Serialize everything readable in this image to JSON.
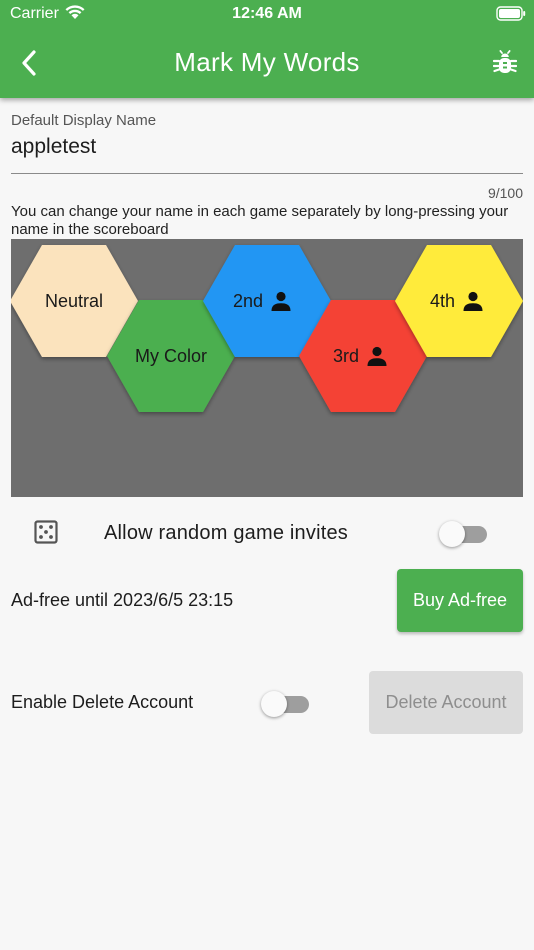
{
  "status_bar": {
    "carrier": "Carrier",
    "time": "12:46 AM"
  },
  "app_bar": {
    "title": "Mark My Words",
    "back_icon": "chevron-left-icon",
    "action_icon": "bug-icon",
    "color": "#4caf50"
  },
  "display_name": {
    "label": "Default Display Name",
    "value": "appletest",
    "counter": "9/100",
    "helper": "You can change your name in each game separately by long-pressing your name in the scoreboard"
  },
  "color_board": {
    "background": "#6e6e6e",
    "hexes": [
      {
        "label": "Neutral",
        "color": "#fbe3bd",
        "player_icon": false
      },
      {
        "label": "My Color",
        "color": "#4caf50",
        "player_icon": false
      },
      {
        "label": "2nd",
        "color": "#2196f3",
        "player_icon": true
      },
      {
        "label": "3rd",
        "color": "#f44336",
        "player_icon": true
      },
      {
        "label": "4th",
        "color": "#ffeb3b",
        "player_icon": true
      }
    ]
  },
  "random_invites": {
    "icon": "dice-icon",
    "label": "Allow random game invites",
    "enabled": false
  },
  "ad_free": {
    "label": "Ad-free until 2023/6/5 23:15",
    "button": "Buy Ad-free"
  },
  "delete_account": {
    "label": "Enable Delete Account",
    "enabled": false,
    "button": "Delete Account"
  }
}
